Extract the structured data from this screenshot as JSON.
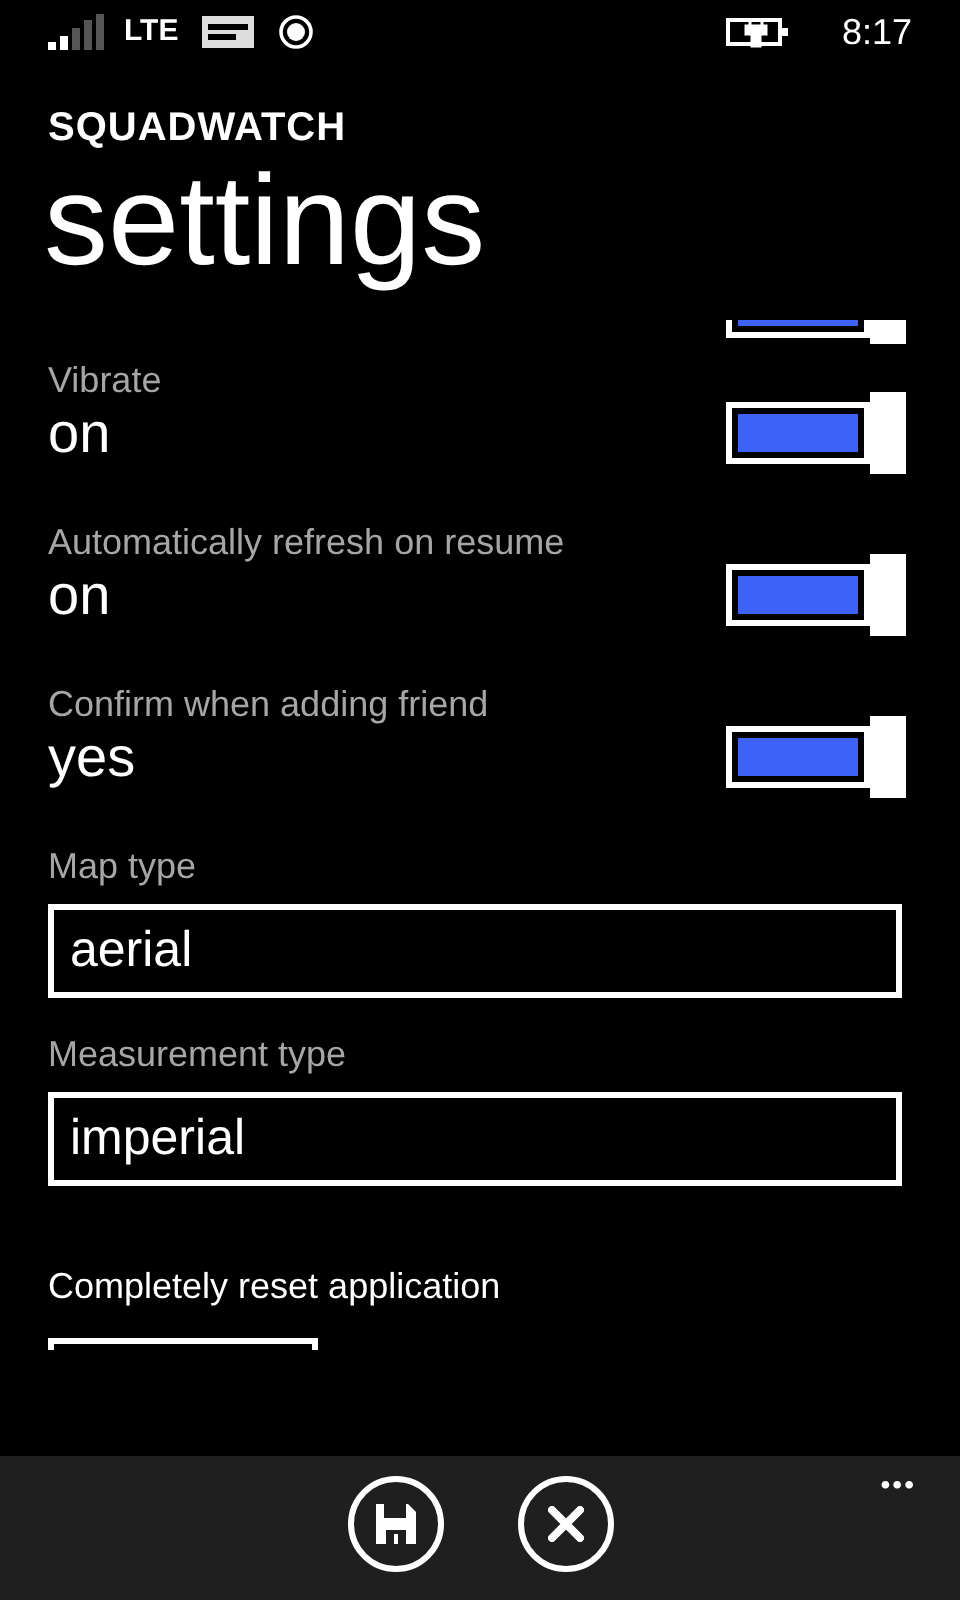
{
  "status_bar": {
    "network": "LTE",
    "time": "8:17"
  },
  "app_title": "SQUADWATCH",
  "page_title": "settings",
  "settings": [
    {
      "kind": "toggle-cut",
      "on": true
    },
    {
      "kind": "toggle",
      "label": "Vibrate",
      "value": "on",
      "on": true
    },
    {
      "kind": "toggle",
      "label": "Automatically refresh on resume",
      "value": "on",
      "on": true
    },
    {
      "kind": "toggle",
      "label": "Confirm when adding friend",
      "value": "yes",
      "on": true
    },
    {
      "kind": "picker",
      "label": "Map type",
      "value": "aerial"
    },
    {
      "kind": "picker",
      "label": "Measurement type",
      "value": "imperial"
    },
    {
      "kind": "button-cut",
      "label": "Completely reset application"
    }
  ],
  "app_bar": {
    "buttons": [
      {
        "kind": "save"
      },
      {
        "kind": "close"
      }
    ],
    "more": "•••"
  }
}
